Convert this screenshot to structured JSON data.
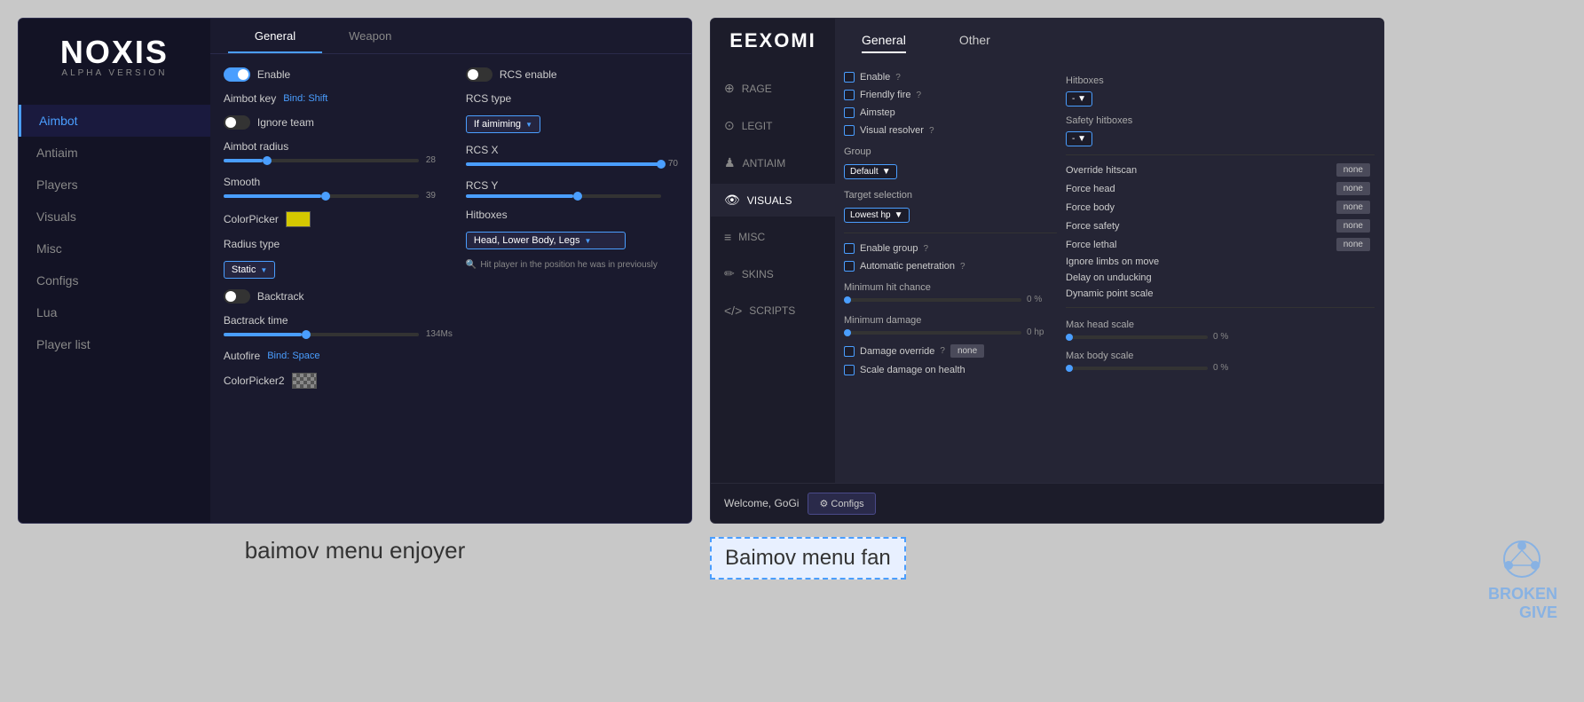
{
  "noxis": {
    "logo": "NOXIS",
    "version": "ALPHA VERSION",
    "nav": {
      "items": [
        {
          "label": "Aimbot",
          "active": true
        },
        {
          "label": "Antiaim",
          "active": false
        },
        {
          "label": "Players",
          "active": false
        },
        {
          "label": "Visuals",
          "active": false
        },
        {
          "label": "Misc",
          "active": false
        },
        {
          "label": "Configs",
          "active": false
        },
        {
          "label": "Lua",
          "active": false
        },
        {
          "label": "Player list",
          "active": false
        }
      ]
    },
    "tabs": [
      {
        "label": "General",
        "active": true
      },
      {
        "label": "Weapon",
        "active": false
      }
    ],
    "left_col": {
      "enable_label": "Enable",
      "aimbot_key_label": "Aimbot key",
      "aimbot_key_bind": "Bind: Shift",
      "ignore_team_label": "Ignore team",
      "aimbot_radius_label": "Aimbot radius",
      "aimbot_radius_value": "28",
      "smooth_label": "Smooth",
      "smooth_value": "39",
      "color_picker_label": "ColorPicker",
      "radius_type_label": "Radius type",
      "radius_type_value": "Static",
      "backtrack_label": "Backtrack",
      "backtrack_time_label": "Bactrack time",
      "backtrack_time_value": "134Ms",
      "autofire_label": "Autofire",
      "autofire_bind": "Bind: Space",
      "color_picker2_label": "ColorPicker2"
    },
    "right_col": {
      "rcs_enable_label": "RCS enable",
      "rcs_type_label": "RCS type",
      "rcs_type_value": "If aimiming",
      "rcs_x_label": "RCS X",
      "rcs_x_value": "70",
      "rcs_y_label": "RCS Y",
      "hitboxes_label": "Hitboxes",
      "hitboxes_value": "Head, Lower Body, Legs",
      "hint_text": "Hit player in the position he was in previously"
    }
  },
  "eexomi": {
    "brand": "EEXOMI",
    "tabs": [
      {
        "label": "General",
        "active": true
      },
      {
        "label": "Other",
        "active": false
      }
    ],
    "nav": {
      "items": [
        {
          "label": "RAGE",
          "icon": "⊕",
          "active": false
        },
        {
          "label": "LEGIT",
          "icon": "⊙",
          "active": false
        },
        {
          "label": "ANTIAIM",
          "icon": "♟",
          "active": false
        },
        {
          "label": "VISUALS",
          "icon": "👁",
          "active": true
        },
        {
          "label": "MISC",
          "icon": "≡",
          "active": false
        },
        {
          "label": "SKINS",
          "icon": "✏",
          "active": false
        },
        {
          "label": "SCRIPTS",
          "icon": "</>",
          "active": false
        }
      ]
    },
    "left": {
      "enable_label": "Enable",
      "enable_q": "?",
      "friendly_fire_label": "Friendly fire",
      "friendly_fire_q": "?",
      "aimstep_label": "Aimstep",
      "visual_resolver_label": "Visual resolver",
      "visual_resolver_q": "?",
      "group_label": "Group",
      "group_value": "Default",
      "target_selection_label": "Target selection",
      "target_value": "Lowest hp",
      "enable_group_label": "Enable group",
      "enable_group_q": "?",
      "auto_penetration_label": "Automatic penetration",
      "auto_penetration_q": "?",
      "min_hit_chance_label": "Minimum hit chance",
      "min_hit_chance_value": "0 %",
      "min_damage_label": "Minimum damage",
      "min_damage_value": "0 hp",
      "damage_override_label": "Damage override",
      "damage_override_q": "?",
      "damage_override_btn": "none",
      "scale_damage_label": "Scale damage on health"
    },
    "right": {
      "hitboxes_label": "Hitboxes",
      "hitboxes_dropdown": "- ▼",
      "safety_hitboxes_label": "Safety hitboxes",
      "safety_dropdown": "- ▼",
      "override_hitscan_label": "Override hitscan",
      "override_hitscan_btn": "none",
      "force_head_label": "Force head",
      "force_head_btn": "none",
      "force_body_label": "Force body",
      "force_body_btn": "none",
      "force_safety_label": "Force safety",
      "force_safety_btn": "none",
      "force_lethal_label": "Force lethal",
      "force_lethal_btn": "none",
      "ignore_limbs_label": "Ignore limbs on move",
      "delay_unduck_label": "Delay on unducking",
      "dynamic_point_label": "Dynamic point scale",
      "max_head_scale_label": "Max head scale",
      "max_head_value": "0 %",
      "max_body_scale_label": "Max body scale",
      "max_body_value": "0 %"
    },
    "footer": {
      "welcome": "Welcome, GoGi",
      "configs_btn": "⚙ Configs"
    }
  },
  "captions": {
    "left": "baimov menu enjoyer",
    "right": "Baimov menu fan"
  },
  "watermark": {
    "line1": "BROKEN",
    "line2": "GIVE"
  }
}
